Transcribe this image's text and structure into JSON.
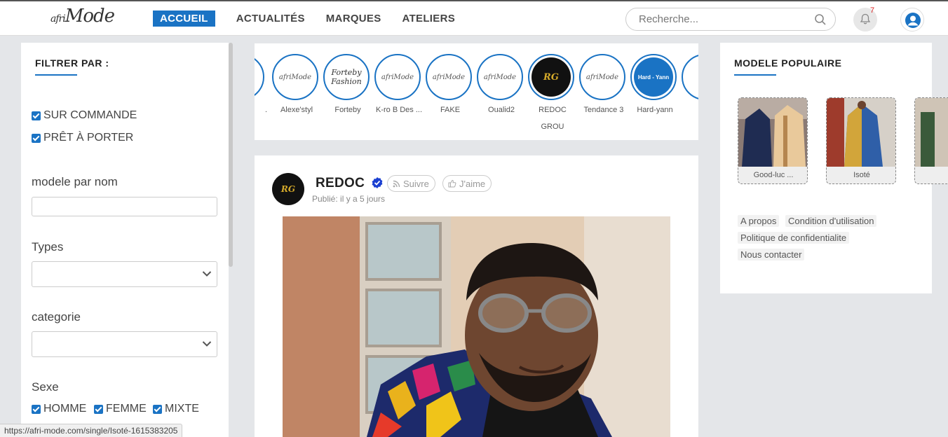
{
  "brand": {
    "logo_main": "afri",
    "logo_tail": "Mode"
  },
  "nav": {
    "items": [
      {
        "label": "ACCUEIL",
        "active": true
      },
      {
        "label": "ACTUALITÉS",
        "active": false
      },
      {
        "label": "MARQUES",
        "active": false
      },
      {
        "label": "ATELIERS",
        "active": false
      }
    ]
  },
  "search": {
    "placeholder": "Recherche..."
  },
  "notifications": {
    "count": "7"
  },
  "filter": {
    "title": "FILTRER PAR :",
    "availability": [
      {
        "label": "SUR COMMANDE",
        "checked": true
      },
      {
        "label": "PRÊT À PORTER",
        "checked": true
      }
    ],
    "name_label": "modele par nom",
    "name_value": "",
    "types_label": "Types",
    "types_value": "",
    "category_label": "categorie",
    "category_value": "",
    "sex_label": "Sexe",
    "sex_options": [
      {
        "label": "HOMME",
        "checked": true
      },
      {
        "label": "FEMME",
        "checked": true
      },
      {
        "label": "MIXTE",
        "checked": true
      }
    ]
  },
  "ateliers": [
    {
      "name": "Alexe'styl",
      "logo": "afriMode",
      "style": "plain"
    },
    {
      "name": "Forteby",
      "logo": "Forteby Fashion",
      "style": "fb"
    },
    {
      "name": "K-ro B Des ...",
      "logo": "afriMode",
      "style": "plain"
    },
    {
      "name": "FAKE",
      "logo": "afriMode",
      "style": "plain"
    },
    {
      "name": "Oualid2",
      "logo": "afriMode",
      "style": "plain"
    },
    {
      "name": "REDOC\nGROU",
      "logo": "RG",
      "style": "dark"
    },
    {
      "name": "Tendance 3",
      "logo": "afriMode",
      "style": "plain"
    },
    {
      "name": "Hard-yann",
      "logo": "Hard - Yann",
      "style": "hv"
    }
  ],
  "post": {
    "author": "REDOC",
    "avatar_text": "RG",
    "follow_label": "Suivre",
    "like_label": "J'aime",
    "published": "Publié: il y a 5 jours"
  },
  "popular": {
    "title": "MODELE POPULAIRE",
    "items": [
      {
        "name": "Good-luc ..."
      },
      {
        "name": "Isoté"
      }
    ]
  },
  "footer_links": [
    "A propos",
    "Condition d'utilisation",
    "Politique de confidentialite",
    "Nous contacter"
  ],
  "status_url": "https://afri-mode.com/single/Isoté-1615383205",
  "colors": {
    "accent": "#1a73c4",
    "background": "#e4e6e9"
  }
}
